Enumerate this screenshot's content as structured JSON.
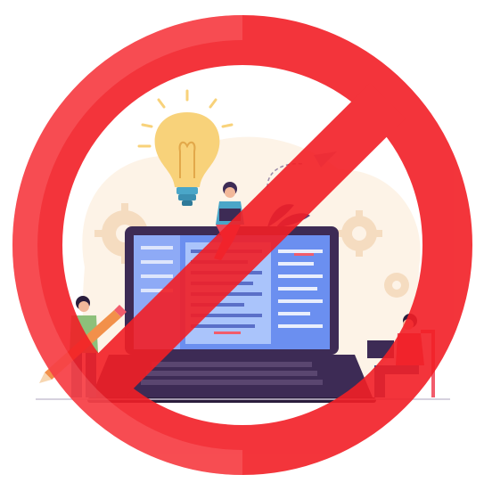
{
  "image": {
    "subject": "prohibition-sign-over-laptop-illustration",
    "colors": {
      "prohibition_red": "#f21f26",
      "prohibition_red_light": "#ff4a4f",
      "background_cream": "#fdf3e7",
      "gear_color": "#f5dcc0",
      "laptop_body": "#3d2b55",
      "laptop_keys": "#5a4670",
      "screen_blue": "#6b8ff0",
      "screen_panel": "#aac4fb",
      "bulb_yellow": "#f8d27a",
      "bulb_base": "#4aa6c8",
      "person_shirt_green": "#8dc07a",
      "person_pants_blue": "#2f4f8a",
      "pencil_orange": "#f2904a"
    },
    "icons": [
      "lightbulb-icon",
      "gear-icon",
      "laptop-icon",
      "paper-plane-icon",
      "pencil-icon"
    ]
  }
}
